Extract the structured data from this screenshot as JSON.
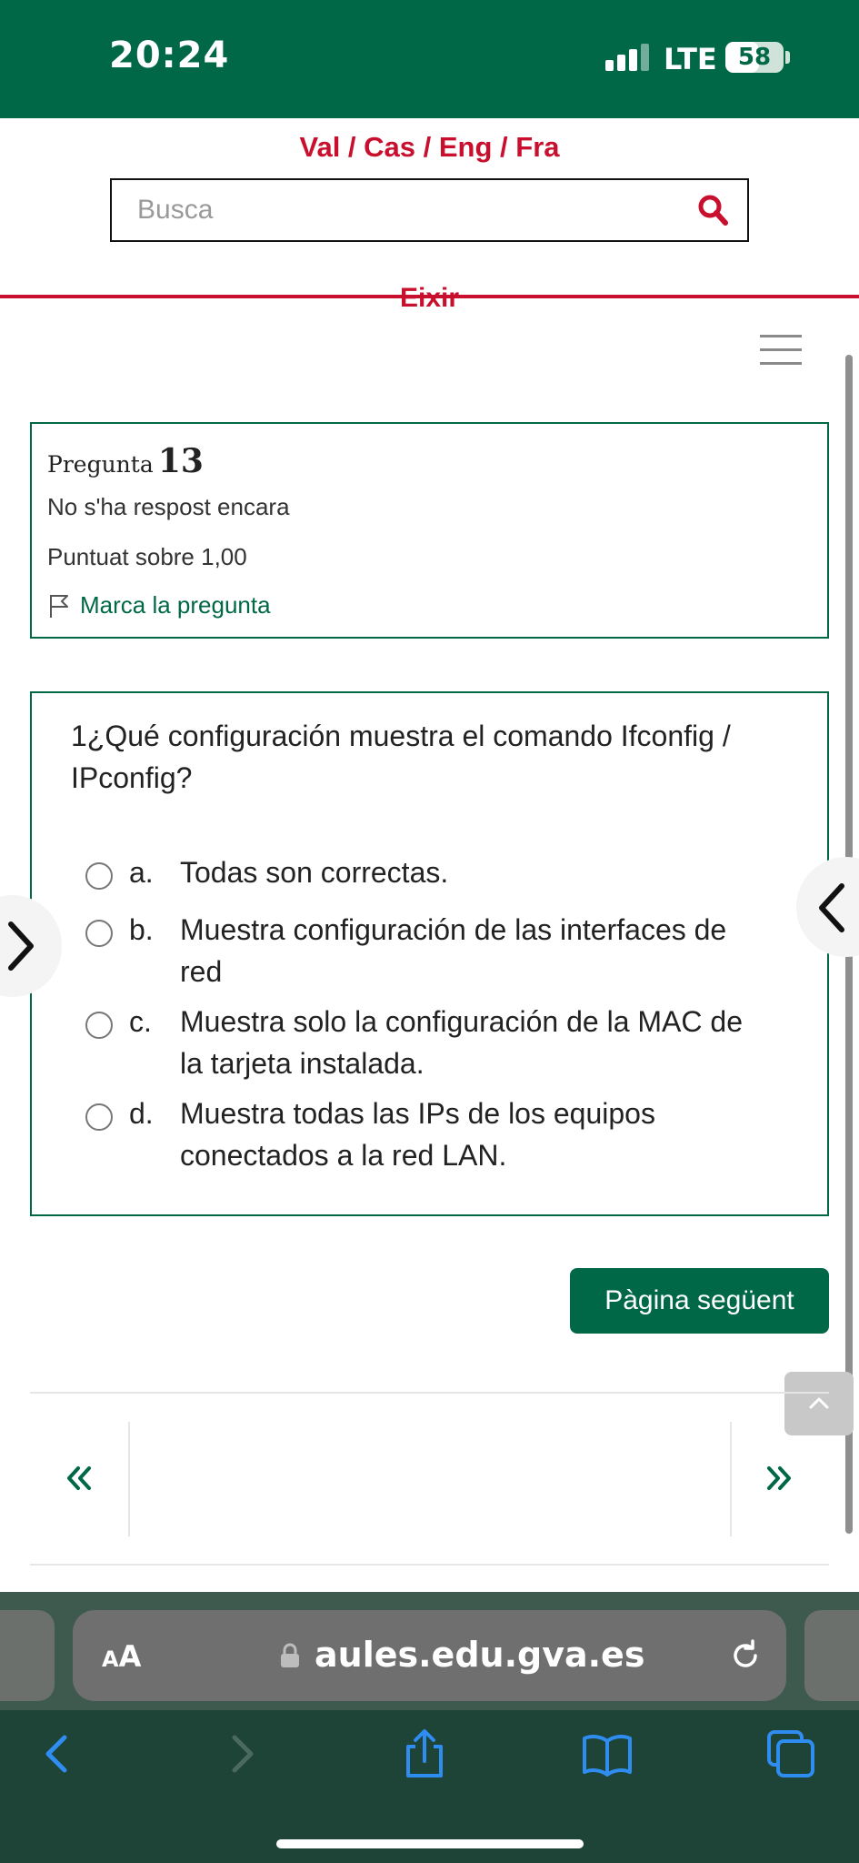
{
  "status_bar": {
    "time": "20:24",
    "network": "LTE",
    "battery": "58",
    "battery_level": 0.58
  },
  "header": {
    "languages": "Val / Cas / Eng / Fra",
    "search_placeholder": "Busca",
    "exit_label": "Eixir"
  },
  "info_card": {
    "question_word": "Pregunta",
    "question_number": "13",
    "status": "No s'ha respost encara",
    "grade": "Puntuat sobre 1,00",
    "flag_label": "Marca la pregunta"
  },
  "question": {
    "text": "1¿Qué configuración muestra el comando Ifconfig / IPconfig?",
    "options": [
      {
        "letter": "a.",
        "text": "Todas son correctas."
      },
      {
        "letter": "b.",
        "text": "Muestra configuración de las interfaces de red"
      },
      {
        "letter": "c.",
        "text": "Muestra solo la configuración de la MAC de la tarjeta instalada."
      },
      {
        "letter": "d.",
        "text": "Muestra todas las IPs de los equipos conectados a la red LAN."
      }
    ]
  },
  "actions": {
    "next_page": "Pàgina següent"
  },
  "browser": {
    "aa_small": "A",
    "aa_big": "A",
    "url": "aules.edu.gva.es"
  },
  "colors": {
    "brand_green": "#006847",
    "brand_red": "#c8102e",
    "safari_toolbar": "#1d4436",
    "safari_blue": "#2f8cf0"
  }
}
